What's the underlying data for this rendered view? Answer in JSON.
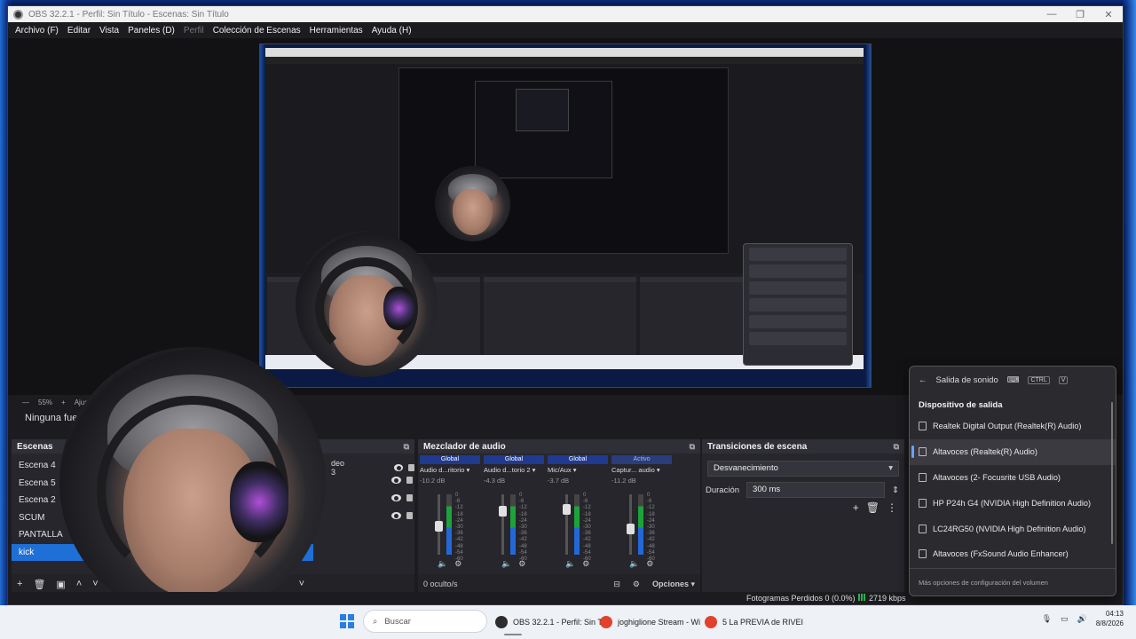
{
  "window": {
    "title": "OBS 32.2.1 - Perfil: Sin Título - Escenas: Sin Título",
    "controls": [
      "—",
      "❐",
      "✕"
    ]
  },
  "menu": [
    "Archivo (F)",
    "Editar",
    "Vista",
    "Paneles (D)",
    "Perfil",
    "Colección de Escenas",
    "Herramientas",
    "Ayuda (H)"
  ],
  "preview": {
    "zoom": "55%",
    "fit_label": "Ajustar",
    "no_source": "Ninguna fuente s"
  },
  "scenes": {
    "title": "Escenas",
    "items": [
      "Escena 4",
      "Escena 5",
      "Escena 2",
      "SCUM",
      "PANTALLA",
      "kick"
    ],
    "selected_index": 5,
    "source_suffix": "deo 3"
  },
  "mixer": {
    "title": "Mezclador de audio",
    "channels": [
      {
        "header": "Global",
        "name": "Audio d...ritorio",
        "db": "-10.2 dB",
        "level": 0.47
      },
      {
        "header": "Global",
        "name": "Audio d...torio 2",
        "db": "-4.3 dB",
        "level": 0.72
      },
      {
        "header": "Global",
        "name": "Mic/Aux",
        "db": "-3.7 dB",
        "level": 0.75
      },
      {
        "header": "Activo",
        "name": "Captur... audio",
        "db": "-11.2 dB",
        "level": 0.43
      }
    ],
    "scale": [
      "0",
      "-6",
      "-12",
      "-18",
      "-24",
      "-30",
      "-36",
      "-42",
      "-48",
      "-54",
      "-60"
    ],
    "hidden": "0 oculto/s",
    "options": "Opciones"
  },
  "transitions": {
    "title": "Transiciones de escena",
    "selected": "Desvanecimiento",
    "duration_label": "Duración",
    "duration_value": "300 ms"
  },
  "status": {
    "frames": "Fotogramas Perdidos 0 (0.0%)",
    "kbps": "2719 kbps"
  },
  "sound_popup": {
    "title": "Salida de sonido",
    "shortcut": [
      "CTRL",
      "V"
    ],
    "section": "Dispositivo de salida",
    "devices": [
      "Realtek Digital Output (Realtek(R) Audio)",
      "Altavoces (Realtek(R) Audio)",
      "Altavoces (2- Focusrite USB Audio)",
      "HP P24h G4 (NVIDIA High Definition Audio)",
      "LC24RG50 (NVIDIA High Definition Audio)",
      "Altavoces (FxSound Audio Enhancer)"
    ],
    "selected_index": 1,
    "more": "Más opciones de configuración del volumen"
  },
  "taskbar": {
    "search_placeholder": "Buscar",
    "apps": [
      {
        "label": "OBS 32.2.1 - Perfil: Sin Ti",
        "color": "#2d2d2d"
      },
      {
        "label": "joghiglione Stream - Wi",
        "color": "#e0422c"
      },
      {
        "label": "5 La PREVIA de RIVEI",
        "color": "#e0422c"
      }
    ],
    "time": "04:13",
    "date": "8/8/2026"
  }
}
